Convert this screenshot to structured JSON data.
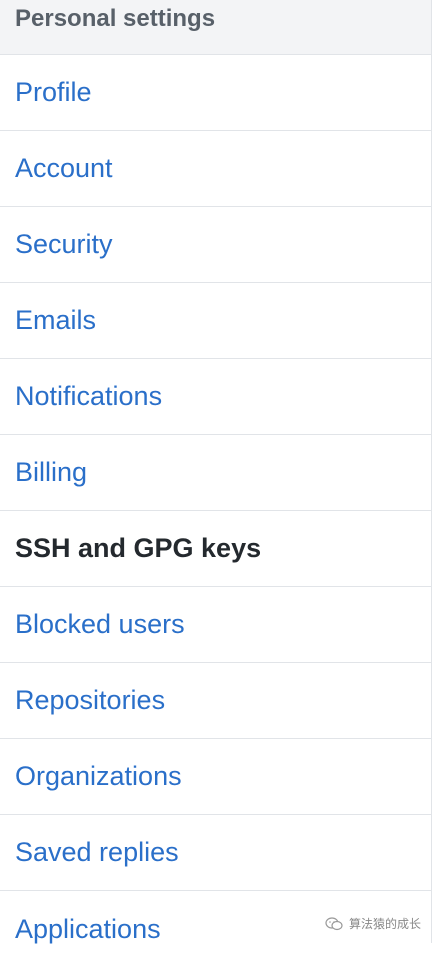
{
  "menu": {
    "heading": "Personal settings",
    "items": [
      {
        "label": "Profile"
      },
      {
        "label": "Account"
      },
      {
        "label": "Security"
      },
      {
        "label": "Emails"
      },
      {
        "label": "Notifications"
      },
      {
        "label": "Billing"
      },
      {
        "label": "SSH and GPG keys"
      },
      {
        "label": "Blocked users"
      },
      {
        "label": "Repositories"
      },
      {
        "label": "Organizations"
      },
      {
        "label": "Saved replies"
      },
      {
        "label": "Applications"
      }
    ],
    "active": "SSH and GPG keys"
  },
  "watermark": {
    "text": "算法猿的成长",
    "icon": "wechat-icon"
  },
  "colors": {
    "link": "#2a6fc9",
    "active_text": "#24292e",
    "heading_text": "#586069",
    "heading_bg": "#f3f4f6",
    "border": "#e1e4e8"
  }
}
